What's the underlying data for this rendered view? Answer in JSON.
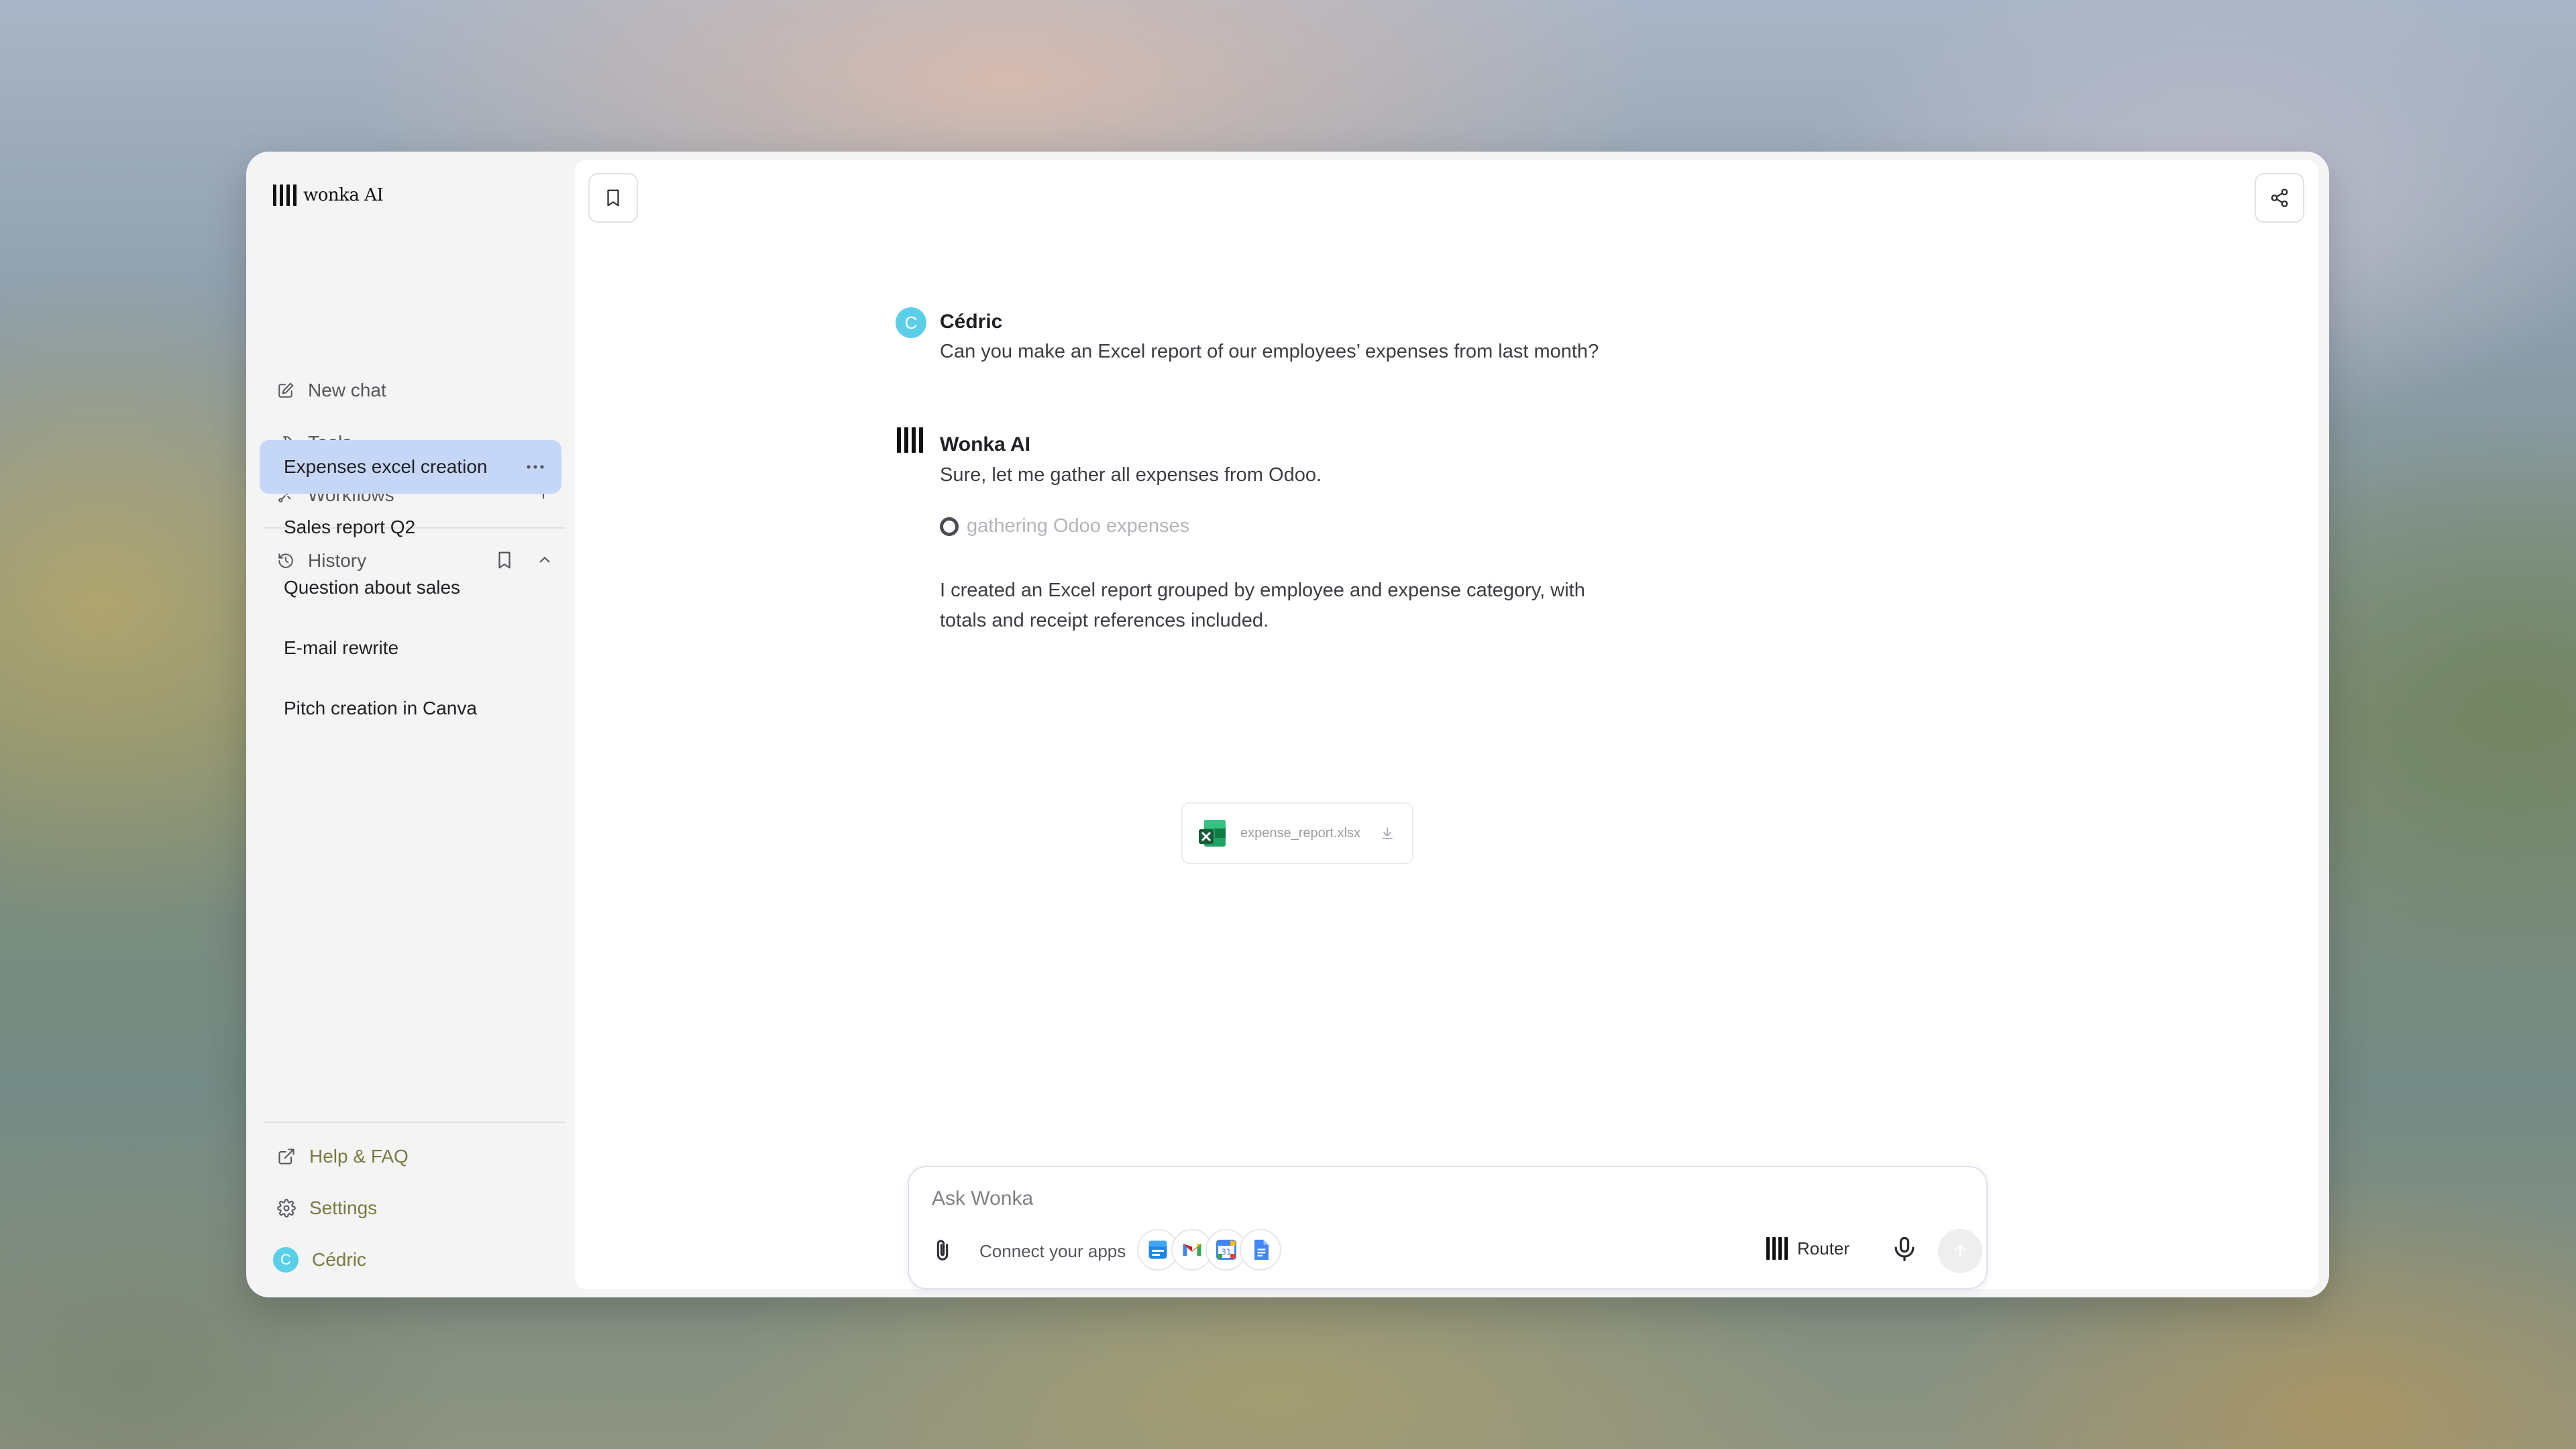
{
  "app": {
    "logo_text": "wonka AI"
  },
  "sidebar": {
    "nav": [
      {
        "label": "New chat",
        "icon": "edit-icon"
      },
      {
        "label": "Tools",
        "icon": "hammer-icon"
      },
      {
        "label": "Workflows",
        "icon": "workflow-icon"
      }
    ],
    "history_label": "History",
    "history_items": [
      {
        "label": "Expenses excel creation",
        "active": true
      },
      {
        "label": "Sales report Q2",
        "active": false
      },
      {
        "label": "Question about sales",
        "active": false
      },
      {
        "label": "E-mail rewrite",
        "active": false
      },
      {
        "label": "Pitch creation in Canva",
        "active": false
      }
    ],
    "footer": {
      "help_label": "Help & FAQ",
      "settings_label": "Settings",
      "user_name": "Cédric",
      "user_initial": "C"
    }
  },
  "conversation": {
    "user_message": {
      "initial": "C",
      "name": "Cédric",
      "text": "Can you make an Excel report of our employees’ expenses from last month?"
    },
    "assistant_message": {
      "name": "Wonka AI",
      "intro": "Sure, let me gather all expenses from Odoo.",
      "tool_status": "gathering Odoo expenses",
      "result_line1": "I created an Excel report grouped by employee and expense category, with",
      "result_line2": "totals and receipt references included.",
      "attachment_name": "expense_report.xlsx"
    }
  },
  "composer": {
    "placeholder": "Ask Wonka",
    "connect_label": "Connect your apps",
    "apps": [
      "calendar-app-icon",
      "gmail-icon",
      "google-calendar-icon",
      "google-docs-icon"
    ],
    "model_label": "Router"
  },
  "colors": {
    "avatar": "#5ccfe8",
    "active_history": "#c6d6f6",
    "excel_green": "#1f7a43"
  }
}
